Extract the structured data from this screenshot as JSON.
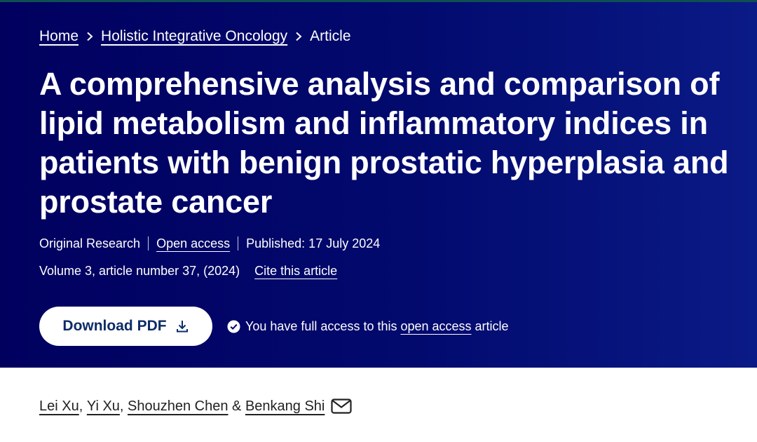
{
  "breadcrumb": {
    "home": "Home",
    "journal": "Holistic Integrative Oncology",
    "current": "Article"
  },
  "article": {
    "title": "A comprehensive analysis and comparison of lipid metabolism and inflammatory indices in patients with benign prostatic hyperplasia and prostate cancer",
    "type": "Original Research",
    "open_access": "Open access",
    "published": "Published: 17 July 2024",
    "volume": "Volume 3, article number 37, (2024)",
    "cite": "Cite this article"
  },
  "actions": {
    "download_pdf": "Download PDF",
    "access_prefix": "You have full access to this",
    "access_link": "open access",
    "access_suffix": "article"
  },
  "authors": {
    "list": [
      "Lei Xu",
      "Yi Xu",
      "Shouzhen Chen",
      "Benkang Shi"
    ],
    "comma": ", ",
    "ampersand": " & "
  },
  "icons": {
    "breadcrumb_separator": "chevron-right-icon",
    "download": "download-icon",
    "check": "check-circle-icon",
    "email": "envelope-icon"
  },
  "colors": {
    "hero_background": "#020a6e",
    "button_text": "#0c2c66",
    "body_text": "#222222"
  }
}
